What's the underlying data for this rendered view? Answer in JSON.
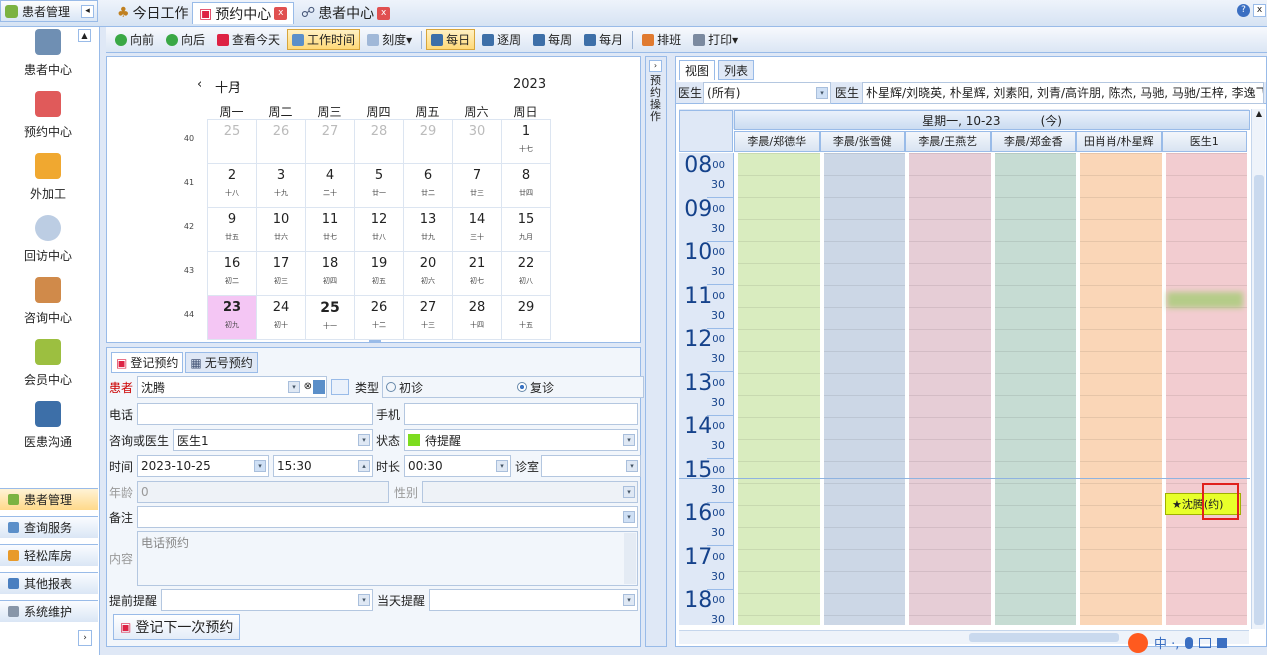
{
  "nav": {
    "header": "患者管理",
    "items": [
      "患者中心",
      "预约中心",
      "外加工",
      "回访中心",
      "咨询中心",
      "会员中心",
      "医患沟通"
    ],
    "accordion": [
      "患者管理",
      "查询服务",
      "轻松库房",
      "其他报表",
      "系统维护"
    ]
  },
  "tabs": [
    "今日工作",
    "预约中心",
    "患者中心"
  ],
  "toolbar": [
    "向前",
    "向后",
    "查看今天",
    "工作时间",
    "刻度▾",
    "每日",
    "逐周",
    "每周",
    "每月",
    "排班",
    "打印▾"
  ],
  "calendar": {
    "month": "十月",
    "year": "2023",
    "weekdays": [
      "周一",
      "周二",
      "周三",
      "周四",
      "周五",
      "周六",
      "周日"
    ],
    "weeks": [
      {
        "wk": "40",
        "days": [
          [
            "25",
            ""
          ],
          [
            "26",
            ""
          ],
          [
            "27",
            ""
          ],
          [
            "28",
            ""
          ],
          [
            "29",
            ""
          ],
          [
            "30",
            ""
          ],
          [
            "1",
            "十七"
          ]
        ]
      },
      {
        "wk": "41",
        "days": [
          [
            "2",
            "十八"
          ],
          [
            "3",
            "十九"
          ],
          [
            "4",
            "二十"
          ],
          [
            "5",
            "廿一"
          ],
          [
            "6",
            "廿二"
          ],
          [
            "7",
            "廿三"
          ],
          [
            "8",
            "廿四"
          ]
        ]
      },
      {
        "wk": "42",
        "days": [
          [
            "9",
            "廿五"
          ],
          [
            "10",
            "廿六"
          ],
          [
            "11",
            "廿七"
          ],
          [
            "12",
            "廿八"
          ],
          [
            "13",
            "廿九"
          ],
          [
            "14",
            "三十"
          ],
          [
            "15",
            "九月"
          ]
        ]
      },
      {
        "wk": "43",
        "days": [
          [
            "16",
            "初二"
          ],
          [
            "17",
            "初三"
          ],
          [
            "18",
            "初四"
          ],
          [
            "19",
            "初五"
          ],
          [
            "20",
            "初六"
          ],
          [
            "21",
            "初七"
          ],
          [
            "22",
            "初八"
          ]
        ]
      },
      {
        "wk": "44",
        "days": [
          [
            "23",
            "初九"
          ],
          [
            "24",
            "初十"
          ],
          [
            "25",
            "十一"
          ],
          [
            "26",
            "十二"
          ],
          [
            "27",
            "十三"
          ],
          [
            "28",
            "十四"
          ],
          [
            "29",
            "十五"
          ]
        ]
      }
    ]
  },
  "side_label": "预约操作",
  "form": {
    "tabs": [
      "登记预约",
      "无号预约"
    ],
    "patient_label": "患者",
    "patient": "沈腾",
    "type_label": "类型",
    "first": "初诊",
    "return": "复诊",
    "phone_label": "电话",
    "mobile_label": "手机",
    "doctor_label": "咨询或医生",
    "doctor": "医生1",
    "status_label": "状态",
    "status": "待提醒",
    "time_label": "时间",
    "date": "2023-10-25",
    "time": "15:30",
    "duration_label": "时长",
    "duration": "00:30",
    "room_label": "诊室",
    "age_label": "年龄",
    "age": "0",
    "gender_label": "性别",
    "note_label": "备注",
    "content_label": "内容",
    "content": "电话预约",
    "remind_label": "提前提醒",
    "dayremind_label": "当天提醒",
    "next_button": "登记下一次预约"
  },
  "schedule": {
    "tabs": [
      "视图",
      "列表"
    ],
    "doctor_label": "医生",
    "doctor_filter": "(所有)",
    "doctor_label2": "医生",
    "doctor_list": "朴星辉/刘晓英, 朴星辉, 刘素阳, 刘青/高许朋, 陈杰, 马驰, 马驰/王梓, 李逸飞, ...",
    "date_header": "星期一, 10-23",
    "today": "(今)",
    "columns": [
      "李晨/郑德华",
      "李晨/张雪健",
      "李晨/王燕艺",
      "李晨/郑金香",
      "田肖肖/朴星辉",
      "医生1"
    ],
    "column_colors": [
      "#d9ecbf",
      "#ccd7e6",
      "#e6cdd6",
      "#c6dcd3",
      "#fad6b7",
      "#f2ccd0"
    ],
    "hours": [
      "08",
      "09",
      "10",
      "11",
      "12",
      "13",
      "14",
      "15",
      "16",
      "17",
      "18"
    ],
    "minutes_label": "00",
    "half_label": "30",
    "appointment": "★沈腾(约)"
  }
}
